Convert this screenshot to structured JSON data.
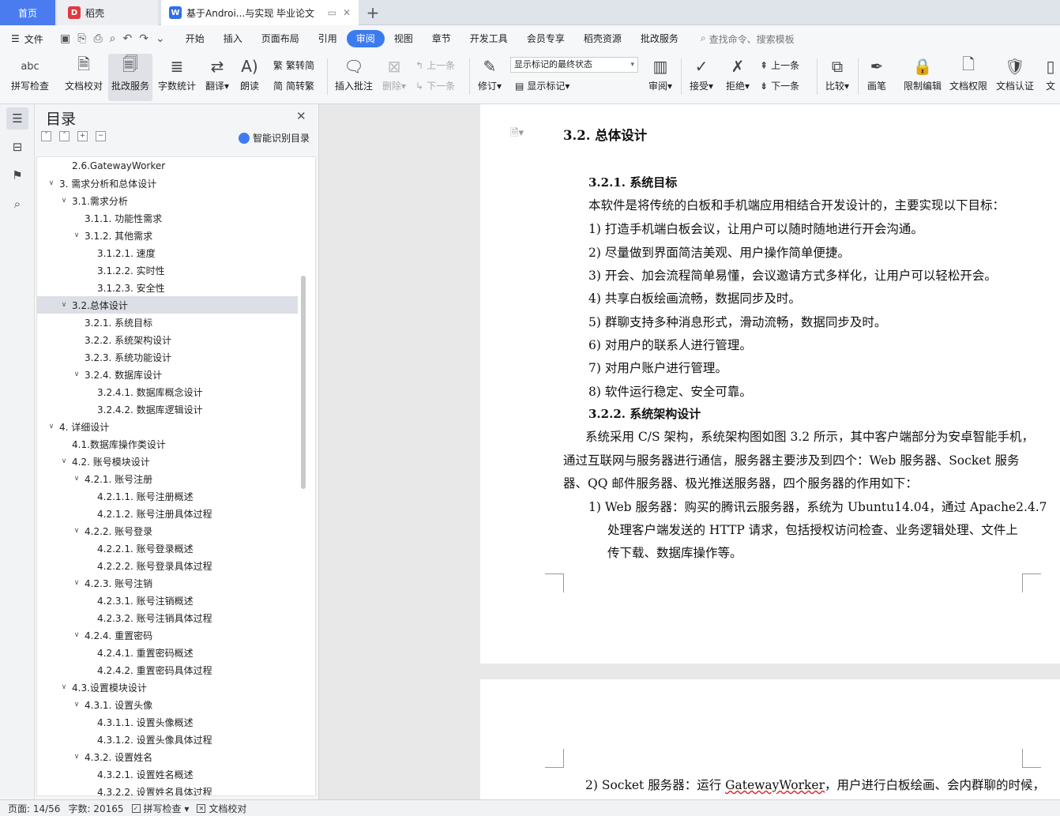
{
  "tabs": {
    "home": "首页",
    "daoke": "稻壳",
    "doc": "基于Androi...与实现 毕业论文"
  },
  "menu": {
    "file": "文件",
    "items": [
      "开始",
      "插入",
      "页面布局",
      "引用",
      "审阅",
      "视图",
      "章节",
      "开发工具",
      "会员专享",
      "稻壳资源",
      "批改服务"
    ],
    "active": "审阅",
    "search": "查找命令、搜索模板"
  },
  "ribbon": {
    "spell": "拼写检查",
    "doccheck": "文档校对",
    "correct": "批改服务",
    "wordcount": "字数统计",
    "translate": "翻译",
    "read": "朗读",
    "trad": "繁转简",
    "simp": "简转繁",
    "insert_comment": "插入批注",
    "delete": "删除",
    "prev_comment": "上一条",
    "next_comment": "下一条",
    "revise": "修订",
    "display_state": "显示标记的最终状态",
    "show_marks": "显示标记",
    "review": "审阅",
    "accept": "接受",
    "reject": "拒绝",
    "prev": "上一条",
    "next": "下一条",
    "compare": "比较",
    "pen": "画笔",
    "restrict": "限制编辑",
    "permission": "文档权限",
    "certify": "文档认证",
    "more": "文"
  },
  "toc": {
    "title": "目录",
    "smart": "智能识别目录",
    "items": [
      {
        "text": "2.6.GatewayWorker",
        "level": 1,
        "chev": ""
      },
      {
        "text": "3.  需求分析和总体设计",
        "level": 0,
        "chev": "v"
      },
      {
        "text": "3.1.需求分析",
        "level": 1,
        "chev": "v"
      },
      {
        "text": "3.1.1.  功能性需求",
        "level": 2,
        "chev": ""
      },
      {
        "text": "3.1.2.  其他需求",
        "level": 2,
        "chev": "v"
      },
      {
        "text": "3.1.2.1.  速度",
        "level": 3,
        "chev": ""
      },
      {
        "text": "3.1.2.2.  实时性",
        "level": 3,
        "chev": ""
      },
      {
        "text": "3.1.2.3.  安全性",
        "level": 3,
        "chev": ""
      },
      {
        "text": "3.2.总体设计",
        "level": 1,
        "chev": "v",
        "sel": true
      },
      {
        "text": "3.2.1.  系统目标",
        "level": 2,
        "chev": ""
      },
      {
        "text": "3.2.2.  系统架构设计",
        "level": 2,
        "chev": ""
      },
      {
        "text": "3.2.3.  系统功能设计",
        "level": 2,
        "chev": ""
      },
      {
        "text": "3.2.4.  数据库设计",
        "level": 2,
        "chev": "v"
      },
      {
        "text": "3.2.4.1.  数据库概念设计",
        "level": 3,
        "chev": ""
      },
      {
        "text": "3.2.4.2.  数据库逻辑设计",
        "level": 3,
        "chev": ""
      },
      {
        "text": "4.  详细设计",
        "level": 0,
        "chev": "v"
      },
      {
        "text": "4.1.数据库操作类设计",
        "level": 1,
        "chev": ""
      },
      {
        "text": "4.2.  账号模块设计",
        "level": 1,
        "chev": "v"
      },
      {
        "text": "4.2.1.  账号注册",
        "level": 2,
        "chev": "v"
      },
      {
        "text": "4.2.1.1.  账号注册概述",
        "level": 3,
        "chev": ""
      },
      {
        "text": "4.2.1.2.  账号注册具体过程",
        "level": 3,
        "chev": ""
      },
      {
        "text": "4.2.2.  账号登录",
        "level": 2,
        "chev": "v"
      },
      {
        "text": "4.2.2.1.  账号登录概述",
        "level": 3,
        "chev": ""
      },
      {
        "text": "4.2.2.2.  账号登录具体过程",
        "level": 3,
        "chev": ""
      },
      {
        "text": "4.2.3.  账号注销",
        "level": 2,
        "chev": "v"
      },
      {
        "text": "4.2.3.1.  账号注销概述",
        "level": 3,
        "chev": ""
      },
      {
        "text": "4.2.3.2.  账号注销具体过程",
        "level": 3,
        "chev": ""
      },
      {
        "text": "4.2.4.  重置密码",
        "level": 2,
        "chev": "v"
      },
      {
        "text": "4.2.4.1.  重置密码概述",
        "level": 3,
        "chev": ""
      },
      {
        "text": "4.2.4.2.  重置密码具体过程",
        "level": 3,
        "chev": ""
      },
      {
        "text": "4.3.设置模块设计",
        "level": 1,
        "chev": "v"
      },
      {
        "text": "4.3.1.  设置头像",
        "level": 2,
        "chev": "v"
      },
      {
        "text": "4.3.1.1.  设置头像概述",
        "level": 3,
        "chev": ""
      },
      {
        "text": "4.3.1.2.  设置头像具体过程",
        "level": 3,
        "chev": ""
      },
      {
        "text": "4.3.2.  设置姓名",
        "level": 2,
        "chev": "v"
      },
      {
        "text": "4.3.2.1.  设置姓名概述",
        "level": 3,
        "chev": ""
      },
      {
        "text": "4.3.2.2.  设置姓名具体过程",
        "level": 3,
        "chev": ""
      }
    ]
  },
  "doc": {
    "h2": "3.2.  总体设计",
    "h3a": "3.2.1.  系统目标",
    "intro": "本软件是将传统的白板和手机端应用相结合开发设计的，主要实现以下目标：",
    "goals": [
      "1)   打造手机端白板会议，让用户可以随时随地进行开会沟通。",
      "2)   尽量做到界面简洁美观、用户操作简单便捷。",
      "3)   开会、加会流程简单易懂，会议邀请方式多样化，让用户可以轻松开会。",
      "4)   共享白板绘画流畅，数据同步及时。",
      "5)   群聊支持多种消息形式，滑动流畅，数据同步及时。",
      "6)   对用户的联系人进行管理。",
      "7)   对用户账户进行管理。",
      "8)   软件运行稳定、安全可靠。"
    ],
    "h3b": "3.2.2.  系统架构设计",
    "arch1": "系统采用 C/S 架构，系统架构图如图 3.2 所示，其中客户端部分为安卓智能手机，",
    "arch2": "通过互联网与服务器进行通信，服务器主要涉及到四个：Web 服务器、Socket 服务",
    "arch3": "器、QQ 邮件服务器、极光推送服务器，四个服务器的作用如下：",
    "web1": "1)   Web 服务器：购买的腾讯云服务器，系统为 Ubuntu14.04，通过 Apache2.4.7",
    "web2": "处理客户端发送的 HTTP 请求，包括授权访问检查、业务逻辑处理、文件上",
    "web3": "传下载、数据库操作等。",
    "socket_pre": "2)   Socket 服务器：运行 ",
    "socket_link": "GatewayWorker",
    "socket_post": "，用户进行白板绘画、会内群聊的时候，"
  },
  "status": {
    "page": "页面: 14/56",
    "words": "字数: 20165",
    "spell": "拼写检查",
    "check": "文档校对"
  }
}
